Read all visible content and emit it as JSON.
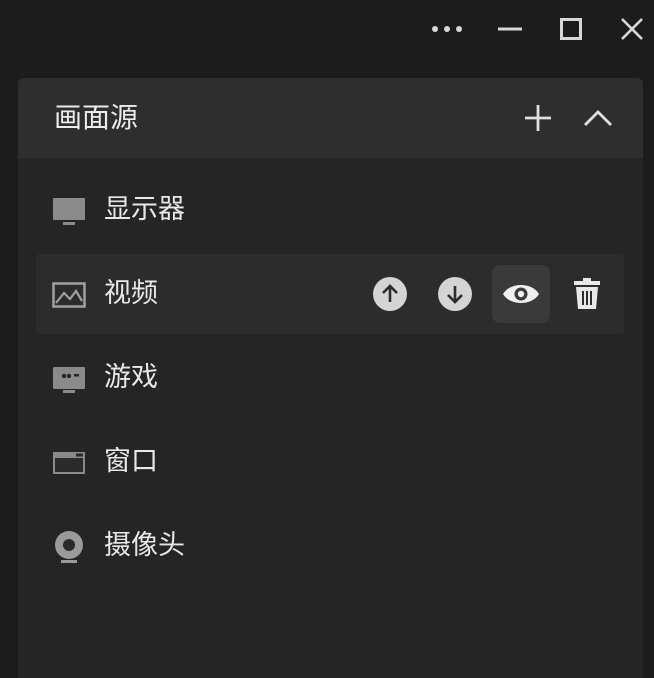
{
  "window": {
    "more_icon": "more-dots-icon",
    "minimize_icon": "minimize-icon",
    "maximize_icon": "maximize-icon",
    "close_icon": "close-icon"
  },
  "panel": {
    "title": "画面源",
    "add_icon": "plus-icon",
    "collapse_icon": "chevron-up-icon"
  },
  "sources": [
    {
      "label": "显示器",
      "icon": "monitor-icon",
      "selected": false
    },
    {
      "label": "视频",
      "icon": "image-icon",
      "selected": true
    },
    {
      "label": "游戏",
      "icon": "game-icon",
      "selected": false
    },
    {
      "label": "窗口",
      "icon": "window-icon",
      "selected": false
    },
    {
      "label": "摄像头",
      "icon": "webcam-icon",
      "selected": false
    }
  ],
  "row_actions": {
    "move_up_icon": "arrow-up-circle-icon",
    "move_down_icon": "arrow-down-circle-icon",
    "visibility_icon": "eye-icon",
    "delete_icon": "trash-icon"
  },
  "colors": {
    "background": "#1c1c1c",
    "panel": "#252525",
    "panel_header": "#2e2e2e",
    "selected_row": "#2c2c2c",
    "active_button": "#3a3a3a",
    "icon": "#d0d0d0"
  }
}
